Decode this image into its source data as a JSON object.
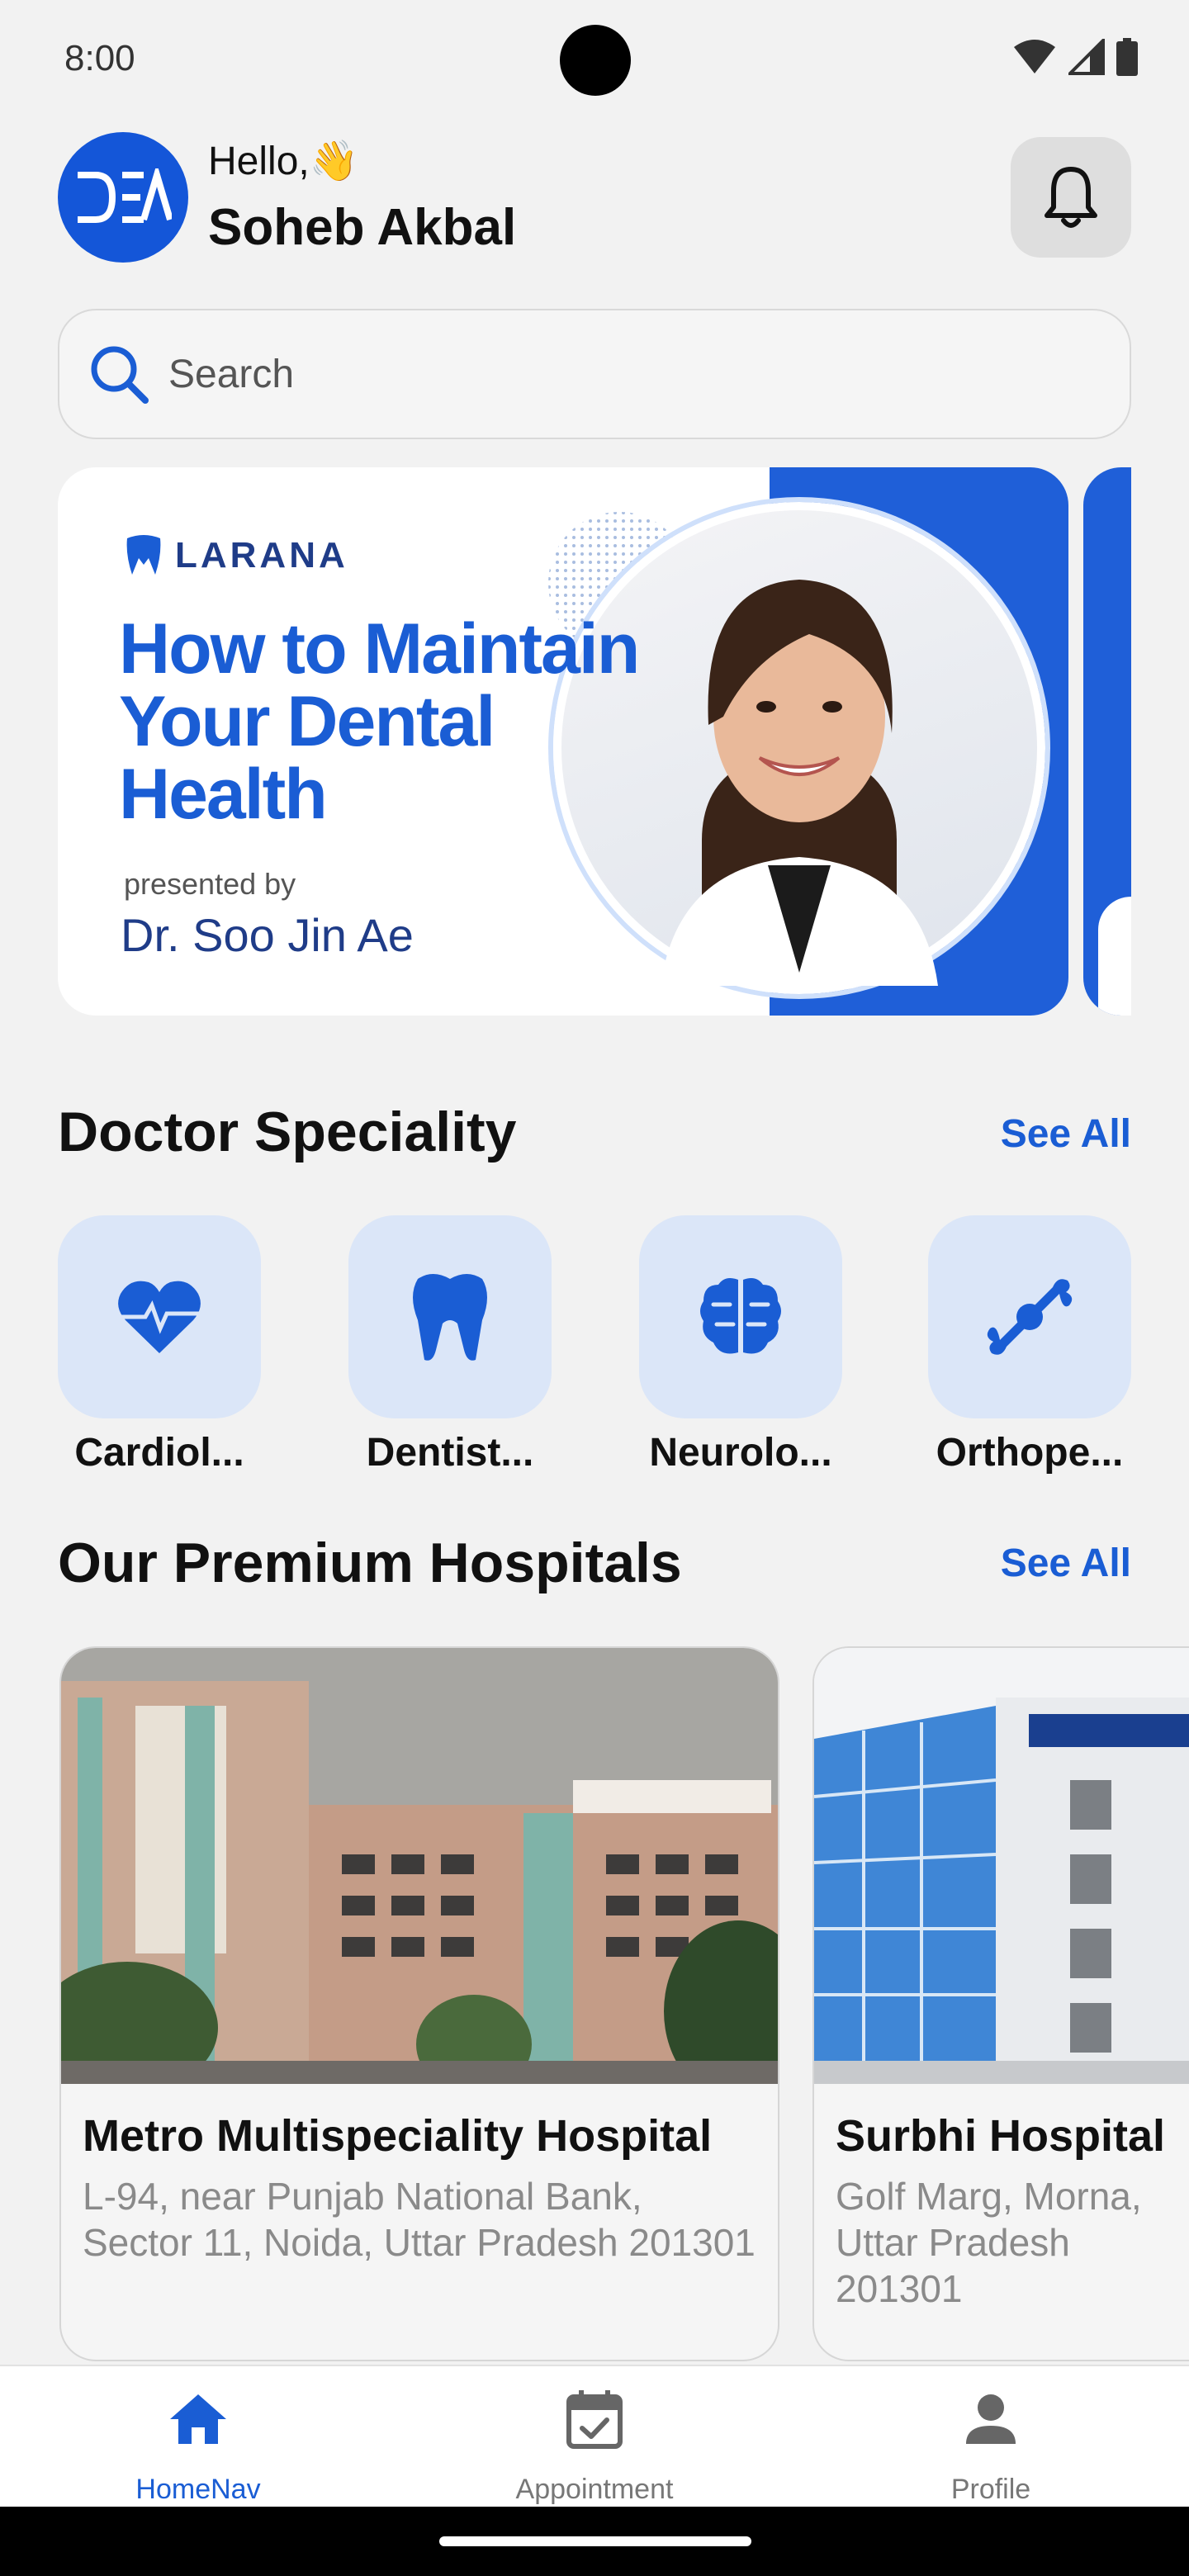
{
  "status_bar": {
    "time": "8:00"
  },
  "header": {
    "avatar_initials": "DEA",
    "greeting": "Hello,👋",
    "user_name": "Soheb Akbal"
  },
  "search": {
    "placeholder": "Search"
  },
  "banner": {
    "brand": "LARANA",
    "title": "How to Maintain Your Dental Health",
    "presented_by": "presented by",
    "doctor": "Dr. Soo Jin Ae"
  },
  "specialities": {
    "title": "Doctor Speciality",
    "see_all": "See All",
    "items": [
      {
        "label": "Cardiol...",
        "icon": "heart-pulse-icon"
      },
      {
        "label": "Dentist...",
        "icon": "tooth-icon"
      },
      {
        "label": "Neurolo...",
        "icon": "brain-icon"
      },
      {
        "label": "Orthope...",
        "icon": "bone-icon"
      }
    ]
  },
  "hospitals": {
    "title": "Our Premium Hospitals",
    "see_all": "See All",
    "items": [
      {
        "name": "Metro Multispeciality Hospital",
        "address": "L-94, near Punjab National Bank, Sector 11, Noida, Uttar Pradesh 201301"
      },
      {
        "name": "Surbhi Hospital",
        "address": "Golf Marg, Morna, Uttar Pradesh 201301"
      }
    ]
  },
  "bottom_nav": {
    "items": [
      {
        "label": "HomeNav",
        "icon": "home-icon",
        "active": true
      },
      {
        "label": "Appointment",
        "icon": "calendar-check-icon",
        "active": false
      },
      {
        "label": "Profile",
        "icon": "person-icon",
        "active": false
      }
    ]
  },
  "colors": {
    "accent": "#1a5dd4",
    "tile_bg": "#dbe6f8",
    "background": "#f2f2f2"
  }
}
